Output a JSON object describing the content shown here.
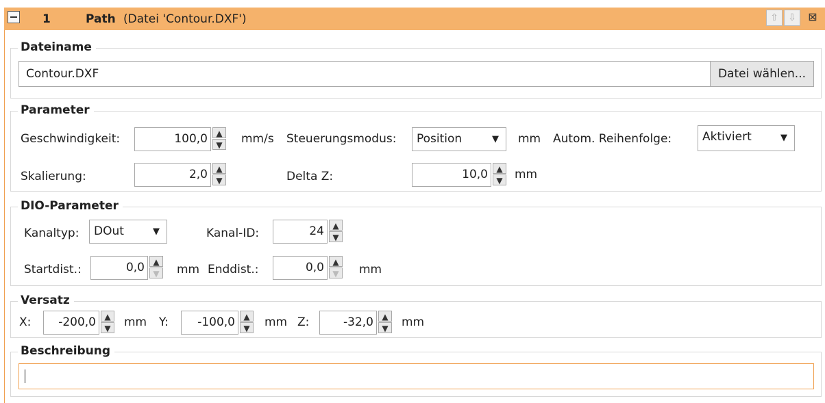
{
  "header": {
    "index": "1",
    "title": "Path",
    "subtitle": "(Datei 'Contour.DXF')",
    "up_icon": "arrow-up-icon",
    "down_icon": "arrow-down-icon",
    "close_icon": "close-icon",
    "color": "#f5b26b"
  },
  "file": {
    "group_label": "Dateiname",
    "filename": "Contour.DXF",
    "choose_button": "Datei wählen..."
  },
  "parameter": {
    "group_label": "Parameter",
    "speed_label": "Geschwindigkeit:",
    "speed_value": "100,0",
    "speed_unit": "mm/s",
    "control_mode_label": "Steuerungsmodus:",
    "control_mode_value": "Position",
    "mm_label": "mm",
    "auto_order_label": "Autom. Reihenfolge:",
    "auto_order_value": "Aktiviert",
    "scaling_label": "Skalierung:",
    "scaling_value": "2,0",
    "delta_z_label": "Delta Z:",
    "delta_z_value": "10,0",
    "delta_z_unit": "mm"
  },
  "dio": {
    "group_label": "DIO-Parameter",
    "channel_type_label": "Kanaltyp:",
    "channel_type_value": "DOut",
    "channel_id_label": "Kanal-ID:",
    "channel_id_value": "24",
    "start_dist_label": "Startdist.:",
    "start_dist_value": "0,0",
    "start_dist_unit": "mm",
    "end_dist_label": "Enddist.:",
    "end_dist_value": "0,0",
    "end_dist_unit": "mm"
  },
  "offset": {
    "group_label": "Versatz",
    "x_label": "X:",
    "x_value": "-200,0",
    "x_unit": "mm",
    "y_label": "Y:",
    "y_value": "-100,0",
    "y_unit": "mm",
    "z_label": "Z:",
    "z_value": "-32,0",
    "z_unit": "mm"
  },
  "description": {
    "group_label": "Beschreibung",
    "value": ""
  }
}
